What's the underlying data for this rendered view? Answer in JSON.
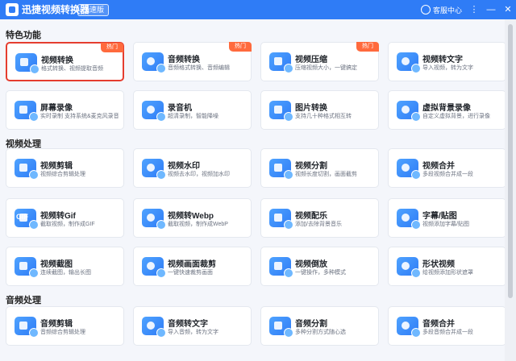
{
  "app": {
    "title": "迅捷视频转换器",
    "badge": "极速版",
    "service": "客服中心",
    "more": "⋮",
    "minimize": "—",
    "close": "✕"
  },
  "sections": {
    "featured": "特色功能",
    "video": "视频处理",
    "audio": "音频处理"
  },
  "hot_label": "热门",
  "featured": [
    {
      "title": "视频转换",
      "desc": "格式转换、视频提取音频",
      "hot": true,
      "icon": "video-convert-icon"
    },
    {
      "title": "音频转换",
      "desc": "音频格式转换、音频编辑",
      "hot": true,
      "icon": "audio-convert-icon"
    },
    {
      "title": "视频压缩",
      "desc": "压缩视频大小，一键搞定",
      "hot": true,
      "icon": "video-compress-icon"
    },
    {
      "title": "视频转文字",
      "desc": "导入视频，转为文字",
      "hot": false,
      "icon": "video-to-text-icon"
    },
    {
      "title": "屏幕录像",
      "desc": "实时录制 支持系统&麦克风录音",
      "hot": false,
      "icon": "screen-record-icon"
    },
    {
      "title": "录音机",
      "desc": "超清录制，智能降噪",
      "hot": false,
      "icon": "recorder-icon"
    },
    {
      "title": "图片转换",
      "desc": "支持几十种格式相互转",
      "hot": false,
      "icon": "image-convert-icon"
    },
    {
      "title": "虚拟背景录像",
      "desc": "自定义虚拟背景，进行录像",
      "hot": false,
      "icon": "virtual-bg-icon"
    }
  ],
  "video": [
    {
      "title": "视频剪辑",
      "desc": "视频综合剪辑处理",
      "icon": "video-edit-icon"
    },
    {
      "title": "视频水印",
      "desc": "视频去水印，视频加水印",
      "icon": "watermark-icon"
    },
    {
      "title": "视频分割",
      "desc": "视频长度切割，画面截剪",
      "icon": "video-split-icon"
    },
    {
      "title": "视频合并",
      "desc": "多段视频合并成一段",
      "icon": "video-merge-icon"
    },
    {
      "title": "视频转Gif",
      "desc": "截取视频，制作成GIF",
      "icon": "gif-icon",
      "glyph": "GIF"
    },
    {
      "title": "视频转Webp",
      "desc": "截取视频，制作成WebP",
      "icon": "webp-icon"
    },
    {
      "title": "视频配乐",
      "desc": "添加/去除背景音乐",
      "icon": "music-icon"
    },
    {
      "title": "字幕/贴图",
      "desc": "视频添加字幕/贴图",
      "icon": "subtitle-icon"
    },
    {
      "title": "视频截图",
      "desc": "连续截图，输出长图",
      "icon": "screenshot-icon"
    },
    {
      "title": "视频画面裁剪",
      "desc": "一键快速裁剪画面",
      "icon": "crop-icon"
    },
    {
      "title": "视频倒放",
      "desc": "一键操作，多种模式",
      "icon": "reverse-icon"
    },
    {
      "title": "形状视频",
      "desc": "给视频添加形状遮罩",
      "icon": "shape-icon"
    }
  ],
  "audio": [
    {
      "title": "音频剪辑",
      "desc": "音频综合剪辑处理",
      "icon": "audio-edit-icon"
    },
    {
      "title": "音频转文字",
      "desc": "导入音频，转为文字",
      "icon": "audio-to-text-icon"
    },
    {
      "title": "音频分割",
      "desc": "多种分割方式随心选",
      "icon": "audio-split-icon"
    },
    {
      "title": "音频合并",
      "desc": "多段音频合并成一段",
      "icon": "audio-merge-icon"
    }
  ]
}
